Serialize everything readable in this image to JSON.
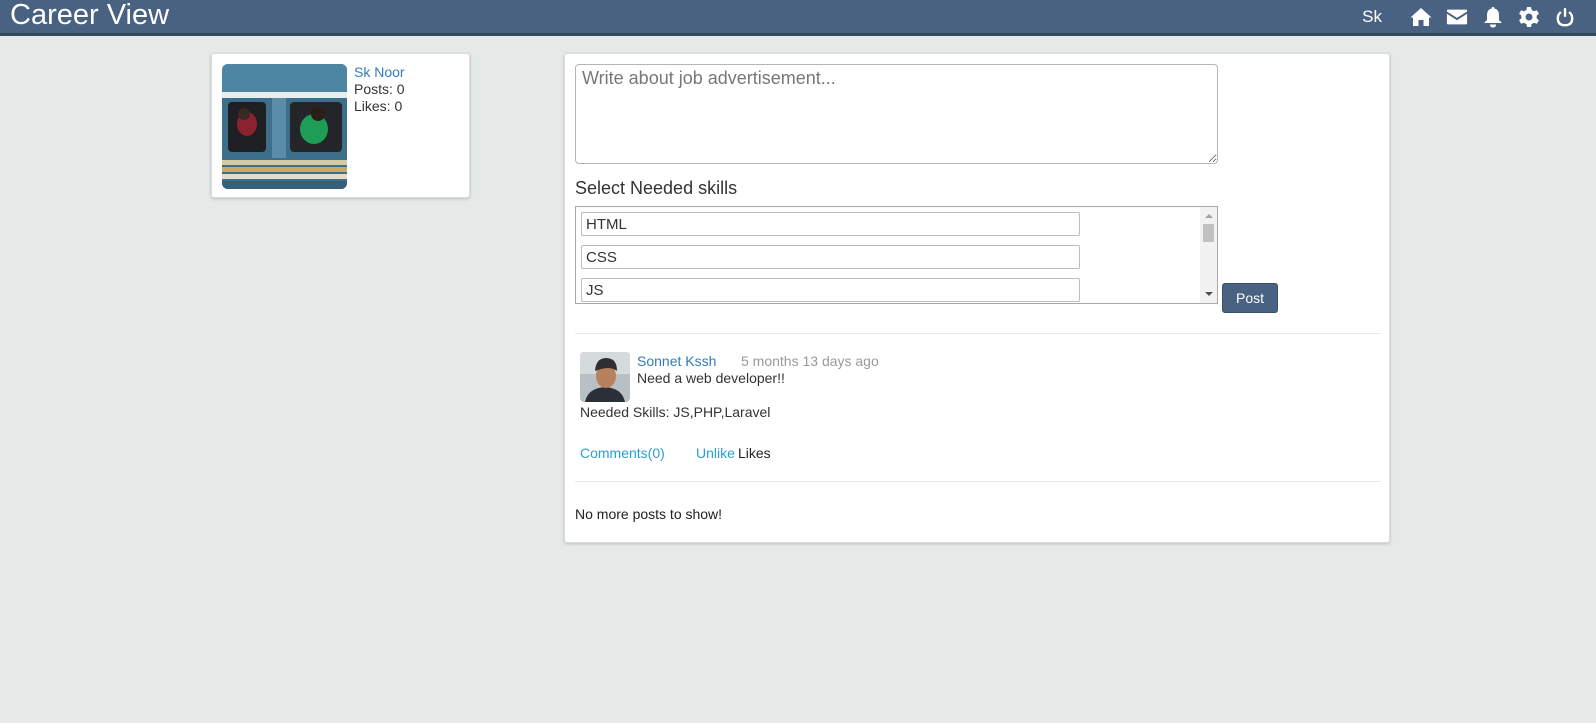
{
  "app": {
    "brand": "Career View",
    "user_initials": "Sk",
    "nav_icons": [
      "home-icon",
      "envelope-icon",
      "bell-icon",
      "gear-icon",
      "power-icon"
    ]
  },
  "profile": {
    "name": "Sk Noor",
    "posts": "Posts: 0",
    "likes": "Likes: 0"
  },
  "composer": {
    "placeholder": "Write about job advertisement...",
    "skills_label": "Select Needed skills",
    "skills": [
      "HTML",
      "CSS",
      "JS"
    ],
    "post_label": "Post"
  },
  "feed": {
    "posts": [
      {
        "author": "Sonnet Kssh",
        "time": "5 months 13 days ago",
        "text": "Need a web developer!!",
        "skills": "Needed Skills: JS,PHP,Laravel",
        "comments": "Comments(0)",
        "like_action": "Unlike",
        "likes_label": "Likes"
      }
    ],
    "end_message": "No more posts to show!"
  },
  "colors": {
    "brand": "#4a6282",
    "link": "#337ab7",
    "action_link": "#2a9fd6",
    "page_bg": "#e5e9e8"
  }
}
